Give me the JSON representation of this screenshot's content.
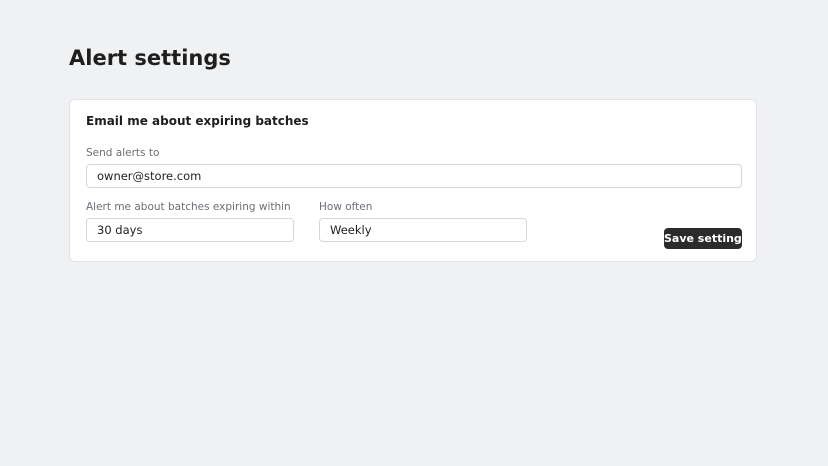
{
  "page": {
    "title": "Alert settings"
  },
  "card": {
    "title": "Email me about expiring batches",
    "send_alerts_to": {
      "label": "Send alerts to",
      "value": "owner@store.com"
    },
    "expiring_within": {
      "label": "Alert me about batches expiring within",
      "value": "30 days"
    },
    "frequency": {
      "label": "How often",
      "value": "Weekly"
    },
    "save_label": "Save settings"
  },
  "colors": {
    "background": "#f0f1f3",
    "card": "#ffffff",
    "button": "#2b2b2b",
    "label_text": "#6b6f75"
  }
}
